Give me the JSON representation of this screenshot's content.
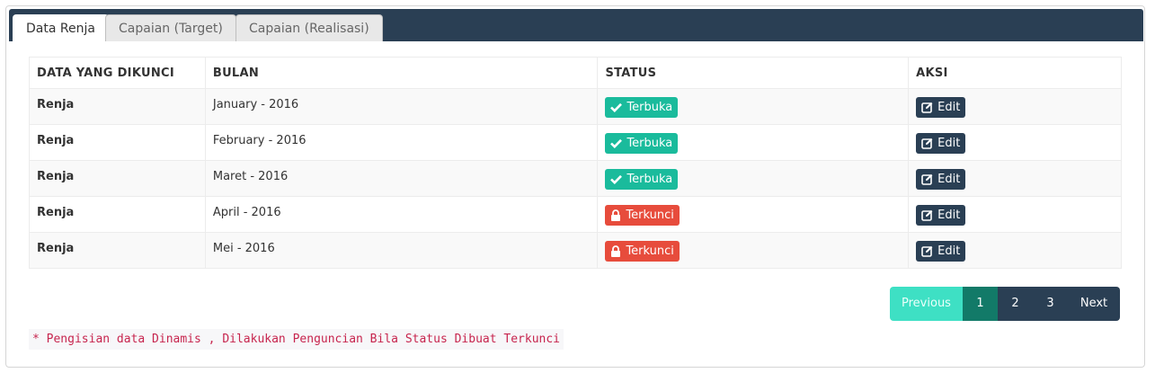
{
  "tabs": [
    {
      "label": "Data Renja",
      "active": true
    },
    {
      "label": "Capaian (Target)",
      "active": false
    },
    {
      "label": "Capaian (Realisasi)",
      "active": false
    }
  ],
  "table": {
    "headers": [
      "DATA YANG DIKUNCI",
      "BULAN",
      "STATUS",
      "AKSI"
    ],
    "rows": [
      {
        "data": "Renja",
        "bulan": "January - 2016",
        "status": "Terbuka",
        "status_icon": "check-icon",
        "action": "Edit"
      },
      {
        "data": "Renja",
        "bulan": "February - 2016",
        "status": "Terbuka",
        "status_icon": "check-icon",
        "action": "Edit"
      },
      {
        "data": "Renja",
        "bulan": "Maret - 2016",
        "status": "Terbuka",
        "status_icon": "check-icon",
        "action": "Edit"
      },
      {
        "data": "Renja",
        "bulan": "April - 2016",
        "status": "Terkunci",
        "status_icon": "lock-icon",
        "action": "Edit"
      },
      {
        "data": "Renja",
        "bulan": "Mei - 2016",
        "status": "Terkunci",
        "status_icon": "lock-icon",
        "action": "Edit"
      }
    ]
  },
  "pagination": {
    "previous": "Previous",
    "pages": [
      "1",
      "2",
      "3"
    ],
    "current": "1",
    "next": "Next"
  },
  "note": "* Pengisian data Dinamis , Dilakukan Penguncian Bila Status Dibuat Terkunci",
  "colors": {
    "header_bg": "#2a3f54",
    "open": "#1abb9c",
    "locked": "#e74c3c",
    "note_text": "#c7254e"
  }
}
